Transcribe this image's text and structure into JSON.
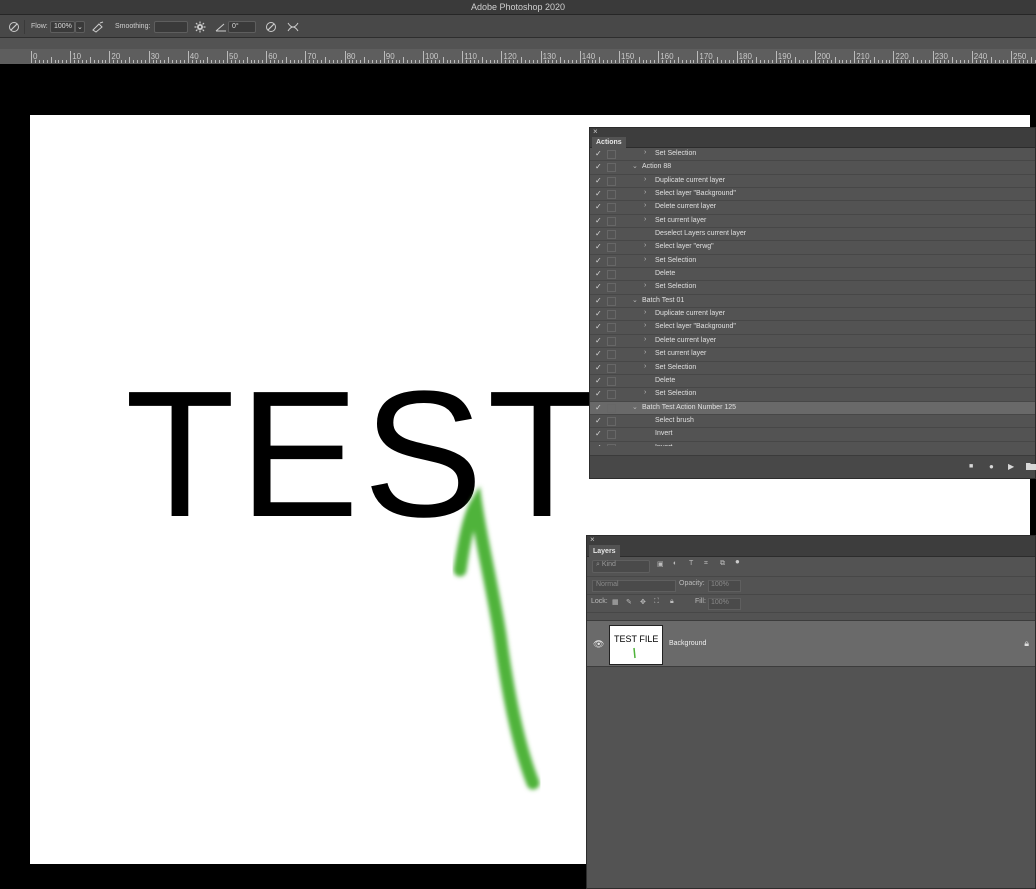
{
  "app": {
    "title": "Adobe Photoshop 2020"
  },
  "options": {
    "flow_label": "Flow:",
    "flow_value": "100%",
    "smoothing_label": "Smoothing:",
    "angle_value": "0°"
  },
  "ruler": {
    "labels": [
      "0",
      "10",
      "20",
      "30",
      "40",
      "50",
      "60",
      "70",
      "80",
      "90",
      "100",
      "110",
      "120",
      "130",
      "140",
      "150",
      "160",
      "170",
      "180",
      "190",
      "200",
      "210",
      "220",
      "230",
      "240",
      "250"
    ]
  },
  "canvas": {
    "text": "TEST"
  },
  "actions": {
    "tab": "Actions",
    "rows": [
      {
        "label": "Set Selection",
        "level": 2,
        "expand": "›"
      },
      {
        "label": "Action 88",
        "level": 1,
        "expand": "⌄"
      },
      {
        "label": "Duplicate current layer",
        "level": 2,
        "expand": "›"
      },
      {
        "label": "Select layer \"Background\"",
        "level": 2,
        "expand": "›"
      },
      {
        "label": "Delete current layer",
        "level": 2,
        "expand": "›"
      },
      {
        "label": "Set current layer",
        "level": 2,
        "expand": "›"
      },
      {
        "label": "Deselect Layers current layer",
        "level": 2,
        "expand": ""
      },
      {
        "label": "Select layer \"erwg\"",
        "level": 2,
        "expand": "›"
      },
      {
        "label": "Set Selection",
        "level": 2,
        "expand": "›"
      },
      {
        "label": "Delete",
        "level": 2,
        "expand": ""
      },
      {
        "label": "Set Selection",
        "level": 2,
        "expand": "›"
      },
      {
        "label": "Batch Test 01",
        "level": 1,
        "expand": "⌄"
      },
      {
        "label": "Duplicate current layer",
        "level": 2,
        "expand": "›"
      },
      {
        "label": "Select layer \"Background\"",
        "level": 2,
        "expand": "›"
      },
      {
        "label": "Delete current layer",
        "level": 2,
        "expand": "›"
      },
      {
        "label": "Set current layer",
        "level": 2,
        "expand": "›"
      },
      {
        "label": "Set Selection",
        "level": 2,
        "expand": "›"
      },
      {
        "label": "Delete",
        "level": 2,
        "expand": ""
      },
      {
        "label": "Set Selection",
        "level": 2,
        "expand": "›"
      },
      {
        "label": "Batch Test Action Number 125",
        "level": 1,
        "expand": "⌄",
        "highlight": true
      },
      {
        "label": "Select brush",
        "level": 2,
        "expand": ""
      },
      {
        "label": "Invert",
        "level": 2,
        "expand": ""
      },
      {
        "label": "Invert",
        "level": 2,
        "expand": ""
      }
    ],
    "footer": {
      "stop": "■",
      "record": "●",
      "play": "▶",
      "folder": "▬"
    }
  },
  "layers": {
    "tab": "Layers",
    "kind_label": "Kind",
    "blend_mode": "Normal",
    "opacity_label": "Opacity:",
    "opacity_value": "100%",
    "lock_label": "Lock:",
    "fill_label": "Fill:",
    "fill_value": "100%",
    "layer_name": "Background",
    "thumb_text": "TEST FILE"
  },
  "colors": {
    "stroke_green": "#4fb33a",
    "panel_bg": "#535353",
    "highlight": "#6a6a6a"
  }
}
